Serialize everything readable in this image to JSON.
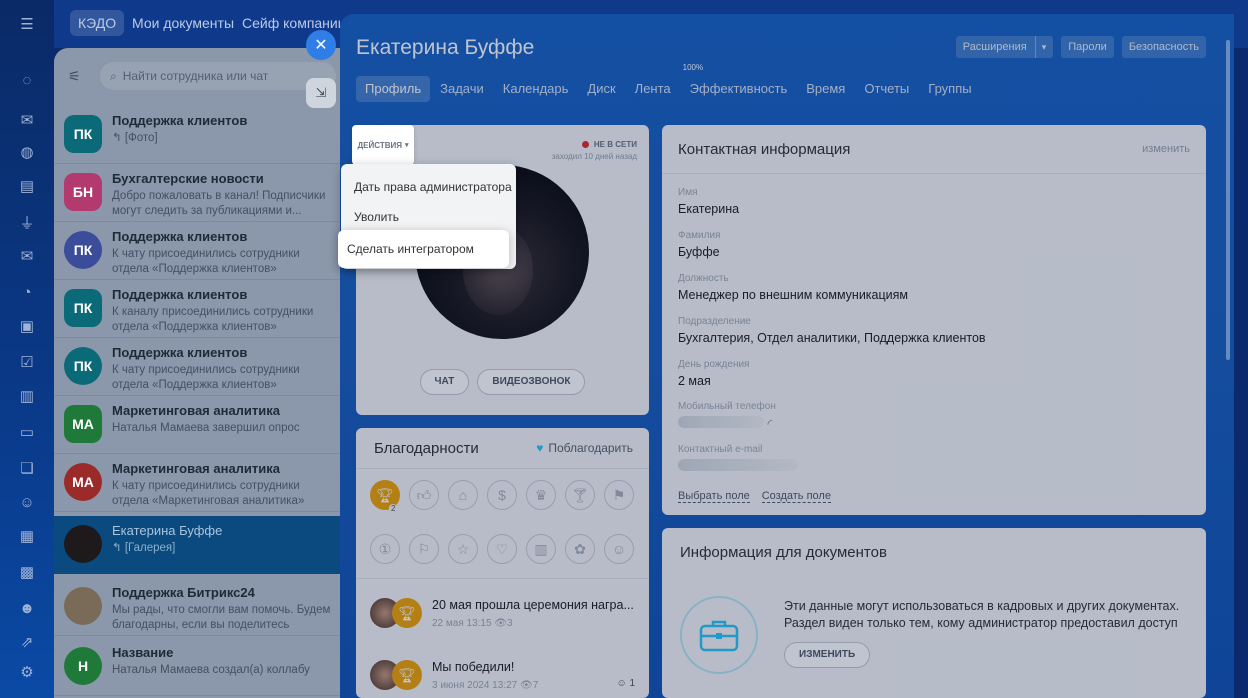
{
  "topbar": {
    "tabs": [
      "КЭДО",
      "Мои документы",
      "Сейф компании"
    ]
  },
  "chat": {
    "search_placeholder": "Найти сотрудника или чат",
    "items": [
      {
        "initials": "ПК",
        "name": "Поддержка клиентов",
        "preview": "↰ [Фото]",
        "color": "#0b6a78"
      },
      {
        "initials": "БН",
        "name": "Бухгалтерские новости",
        "preview": "Добро пожаловать в канал! Подписчики могут следить за публикациями и...",
        "color": "#b23a6e"
      },
      {
        "initials": "ПК",
        "name": "Поддержка клиентов",
        "preview": "К чату присоединились сотрудники отдела «Поддержка клиентов»",
        "color": "#3a4c9a"
      },
      {
        "initials": "ПК",
        "name": "Поддержка клиентов",
        "preview": "К каналу присоединились сотрудники отдела «Поддержка клиентов»",
        "color": "#0b6a78"
      },
      {
        "initials": "ПК",
        "name": "Поддержка клиентов",
        "preview": "К чату присоединились сотрудники отдела «Поддержка клиентов»",
        "color": "#0b6a78"
      },
      {
        "initials": "МА",
        "name": "Маркетинговая аналитика",
        "preview": "Наталья Мамаева завершил опрос",
        "color": "#1f7a3a"
      },
      {
        "initials": "МА",
        "name": "Маркетинговая аналитика",
        "preview": "К чату присоединились сотрудники отдела «Маркетинговая аналитика»",
        "color": "#9b2a2a"
      },
      {
        "initials": "",
        "name": "Екатерина Буффе",
        "preview": "↰ [Галерея]",
        "color": "#1e1a1c"
      },
      {
        "initials": "",
        "name": "Поддержка Битрикс24",
        "preview": "Мы рады, что смогли вам помочь. Будем благодарны, если вы поделитесь своим...",
        "color": "#7a6a58"
      },
      {
        "initials": "Н",
        "name": "Название",
        "preview": "Наталья Мамаева создал(а) коллабу",
        "color": "#1f7a3a"
      }
    ]
  },
  "profile": {
    "name": "Екатерина Буффе",
    "header_buttons": {
      "extensions": "Расширения",
      "passwords": "Пароли",
      "security": "Безопасность"
    },
    "tabs": [
      "Профиль",
      "Задачи",
      "Календарь",
      "Диск",
      "Лента",
      "Эффективность",
      "Время",
      "Отчеты",
      "Группы"
    ],
    "efficiency_badge": "100%",
    "status": "НЕ В СЕТИ",
    "last_seen": "заходил 10 дней назад",
    "actions_label": "ДЕЙСТВИЯ",
    "actions_menu": [
      "Дать права администратора",
      "Уволить",
      "Сделать интегратором"
    ],
    "buttons": {
      "chat": "ЧАТ",
      "video": "ВИДЕОЗВОНОК"
    }
  },
  "thanks": {
    "title": "Благодарности",
    "link": "Поблагодарить",
    "badge_count": "2",
    "posts": [
      {
        "title": "20 мая прошла церемония награ...",
        "meta": "22 мая 13:15",
        "views": "3",
        "reactions": ""
      },
      {
        "title": "Мы победили!",
        "meta": "3 июня 2024 13:27",
        "views": "7",
        "reactions": "1"
      }
    ]
  },
  "contact": {
    "title": "Контактная информация",
    "edit": "изменить",
    "fields": [
      {
        "label": "Имя",
        "value": "Екатерина"
      },
      {
        "label": "Фамилия",
        "value": "Буффе"
      },
      {
        "label": "Должность",
        "value": "Менеджер по внешним коммуникациям"
      },
      {
        "label": "Подразделение",
        "value": "Бухгалтерия, Отдел аналитики, Поддержка клиентов"
      },
      {
        "label": "День рождения",
        "value": "2 мая"
      },
      {
        "label": "Мобильный телефон",
        "value": ""
      },
      {
        "label": "Контактный e-mail",
        "value": ""
      }
    ],
    "links": {
      "choose": "Выбрать поле",
      "create": "Создать поле"
    }
  },
  "docs": {
    "title": "Информация для документов",
    "text": "Эти данные могут использоваться в кадровых и других документах. Раздел виден только тем, кому администратор предоставил доступ",
    "button": "ИЗМЕНИТЬ"
  }
}
